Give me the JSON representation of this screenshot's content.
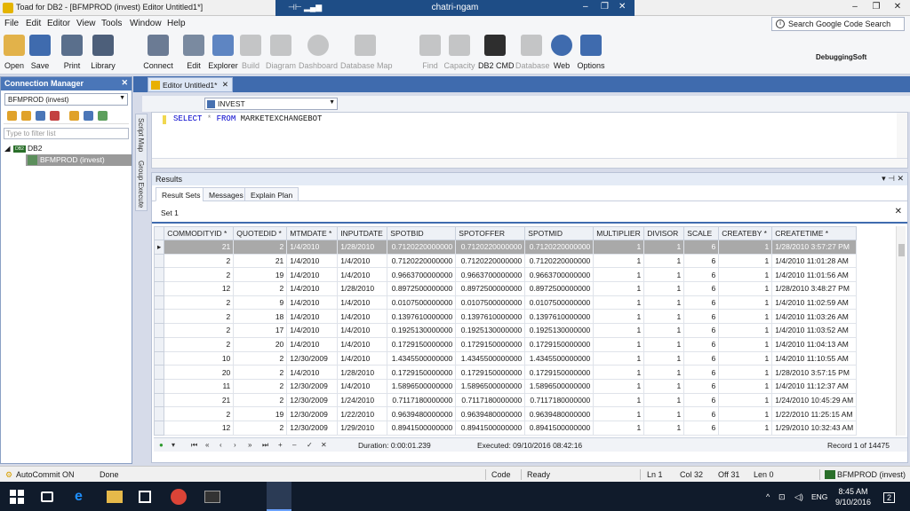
{
  "window": {
    "title": "Toad for DB2 - [BFMPROD (invest) Editor Untitled1*]",
    "remote_host": "chatri-ngam"
  },
  "menu": [
    "File",
    "Edit",
    "Editor",
    "View",
    "Tools",
    "Window",
    "Help"
  ],
  "search": {
    "placeholder": "Search Google Code Search"
  },
  "toolbar": {
    "items": [
      {
        "label": "Open",
        "icon": "folder-open-icon",
        "enabled": true
      },
      {
        "label": "Save",
        "icon": "save-icon",
        "enabled": true
      },
      {
        "label": "Print",
        "icon": "printer-icon",
        "enabled": true
      },
      {
        "label": "Library",
        "icon": "library-icon",
        "enabled": true
      },
      {
        "label": "Connect",
        "icon": "connect-plug-icon",
        "enabled": true
      },
      {
        "label": "Edit",
        "icon": "edit-icon",
        "enabled": true
      },
      {
        "label": "Explorer",
        "icon": "database-explorer-icon",
        "enabled": true
      },
      {
        "label": "Build",
        "icon": "build-icon",
        "enabled": false
      },
      {
        "label": "Diagram",
        "icon": "diagram-icon",
        "enabled": false
      },
      {
        "label": "Dashboard",
        "icon": "dashboard-gauge-icon",
        "enabled": false
      },
      {
        "label": "Database Map",
        "icon": "database-map-icon",
        "enabled": false
      },
      {
        "label": "Find",
        "icon": "find-icon",
        "enabled": false
      },
      {
        "label": "Capacity",
        "icon": "capacity-icon",
        "enabled": false
      },
      {
        "label": "DB2 CMD",
        "icon": "command-prompt-icon",
        "enabled": true
      },
      {
        "label": "Database",
        "icon": "database-icon",
        "enabled": false
      },
      {
        "label": "Web",
        "icon": "globe-icon",
        "enabled": true
      },
      {
        "label": "Options",
        "icon": "options-icon",
        "enabled": true
      }
    ],
    "brand": "DebuggingSoft"
  },
  "connection_manager": {
    "title": "Connection Manager",
    "selected": "BFMPROD (invest)",
    "filter_placeholder": "Type to filter list",
    "tree": {
      "root": "DB2",
      "child": "BFMPROD (invest)"
    }
  },
  "side_tabs": [
    "Script Map",
    "Group Execute"
  ],
  "editor": {
    "tab_label": "Editor Untitled1*",
    "connection": "INVEST",
    "sql": {
      "kw1": "SELECT",
      "op": "*",
      "kw2": "FROM",
      "table": "MARKETEXCHANGEBOT"
    }
  },
  "results": {
    "title": "Results",
    "tabs": [
      "Result Sets",
      "Messages",
      "Explain Plan"
    ],
    "set_tab": "Set 1",
    "columns": [
      "COMMODITYID *",
      "QUOTEDID *",
      "MTMDATE *",
      "INPUTDATE",
      "SPOTBID",
      "SPOTOFFER",
      "SPOTMID",
      "MULTIPLIER",
      "DIVISOR",
      "SCALE",
      "CREATEBY *",
      "CREATETIME *"
    ],
    "rows": [
      [
        "21",
        "2",
        "1/4/2010",
        "1/28/2010",
        "0.7120220000000",
        "0.7120220000000",
        "0.7120220000000",
        "1",
        "1",
        "6",
        "1",
        "1/28/2010 3:57:27 PM"
      ],
      [
        "2",
        "21",
        "1/4/2010",
        "1/4/2010",
        "0.7120220000000",
        "0.7120220000000",
        "0.7120220000000",
        "1",
        "1",
        "6",
        "1",
        "1/4/2010 11:01:28 AM"
      ],
      [
        "2",
        "19",
        "1/4/2010",
        "1/4/2010",
        "0.9663700000000",
        "0.9663700000000",
        "0.9663700000000",
        "1",
        "1",
        "6",
        "1",
        "1/4/2010 11:01:56 AM"
      ],
      [
        "12",
        "2",
        "1/4/2010",
        "1/28/2010",
        "0.8972500000000",
        "0.8972500000000",
        "0.8972500000000",
        "1",
        "1",
        "6",
        "1",
        "1/28/2010 3:48:27 PM"
      ],
      [
        "2",
        "9",
        "1/4/2010",
        "1/4/2010",
        "0.0107500000000",
        "0.0107500000000",
        "0.0107500000000",
        "1",
        "1",
        "6",
        "1",
        "1/4/2010 11:02:59 AM"
      ],
      [
        "2",
        "18",
        "1/4/2010",
        "1/4/2010",
        "0.1397610000000",
        "0.1397610000000",
        "0.1397610000000",
        "1",
        "1",
        "6",
        "1",
        "1/4/2010 11:03:26 AM"
      ],
      [
        "2",
        "17",
        "1/4/2010",
        "1/4/2010",
        "0.1925130000000",
        "0.1925130000000",
        "0.1925130000000",
        "1",
        "1",
        "6",
        "1",
        "1/4/2010 11:03:52 AM"
      ],
      [
        "2",
        "20",
        "1/4/2010",
        "1/4/2010",
        "0.1729150000000",
        "0.1729150000000",
        "0.1729150000000",
        "1",
        "1",
        "6",
        "1",
        "1/4/2010 11:04:13 AM"
      ],
      [
        "10",
        "2",
        "12/30/2009",
        "1/4/2010",
        "1.4345500000000",
        "1.4345500000000",
        "1.4345500000000",
        "1",
        "1",
        "6",
        "1",
        "1/4/2010 11:10:55 AM"
      ],
      [
        "20",
        "2",
        "1/4/2010",
        "1/28/2010",
        "0.1729150000000",
        "0.1729150000000",
        "0.1729150000000",
        "1",
        "1",
        "6",
        "1",
        "1/28/2010 3:57:15 PM"
      ],
      [
        "11",
        "2",
        "12/30/2009",
        "1/4/2010",
        "1.5896500000000",
        "1.5896500000000",
        "1.5896500000000",
        "1",
        "1",
        "6",
        "1",
        "1/4/2010 11:12:37 AM"
      ],
      [
        "21",
        "2",
        "12/30/2009",
        "1/24/2010",
        "0.7117180000000",
        "0.7117180000000",
        "0.7117180000000",
        "1",
        "1",
        "6",
        "1",
        "1/24/2010 10:45:29 AM"
      ],
      [
        "2",
        "19",
        "12/30/2009",
        "1/22/2010",
        "0.9639480000000",
        "0.9639480000000",
        "0.9639480000000",
        "1",
        "1",
        "6",
        "1",
        "1/22/2010 11:25:15 AM"
      ],
      [
        "12",
        "2",
        "12/30/2009",
        "1/29/2010",
        "0.8941500000000",
        "0.8941500000000",
        "0.8941500000000",
        "1",
        "1",
        "6",
        "1",
        "1/29/2010 10:32:43 AM"
      ]
    ],
    "duration": "Duration: 0:00:01.239",
    "executed": "Executed: 09/10/2016 08:42:16",
    "record": "Record 1 of 14475"
  },
  "status": {
    "autocommit": "AutoCommit ON",
    "state": "Done",
    "mode": "Code",
    "ready": "Ready",
    "line": "Ln 1",
    "col": "Col 32",
    "off": "Off 31",
    "len": "Len 0",
    "connection": "BFMPROD (invest)"
  },
  "taskbar": {
    "time": "8:45 AM",
    "date": "9/10/2016",
    "lang": "ENG",
    "notifications": "2"
  },
  "colors": {
    "accent": "#3f6bae",
    "selection": "#a9a9a9",
    "taskbar": "#101b2b"
  }
}
